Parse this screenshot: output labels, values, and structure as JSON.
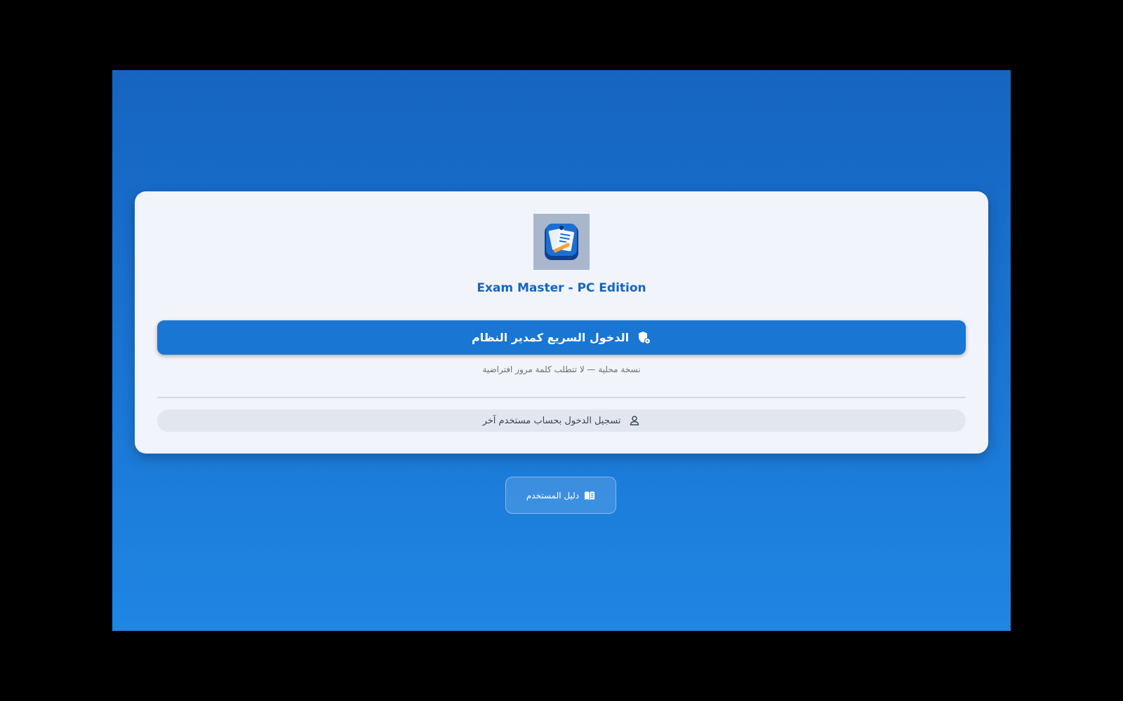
{
  "app": {
    "title": "Exam Master - PC Edition",
    "logo_icon": "exam-app-logo"
  },
  "login": {
    "admin_button_label": "الدخول السريع كمدير النظام",
    "admin_button_icon": "admin-shield-icon",
    "local_note": "نسخة محلية — لا تتطلب كلمة مرور افتراضية",
    "other_user_label": "تسجيل الدخول بحساب مستخدم آخر",
    "other_user_icon": "user-icon"
  },
  "footer": {
    "guide_label": "دليل المستخدم",
    "guide_icon": "book-icon"
  },
  "colors": {
    "background_top": "#1565c0",
    "background_bottom": "#1f86e3",
    "card": "#f1f4fa",
    "primary_button": "#1976d2",
    "title_text": "#1565c0",
    "secondary_button": "#e2e7ef"
  }
}
